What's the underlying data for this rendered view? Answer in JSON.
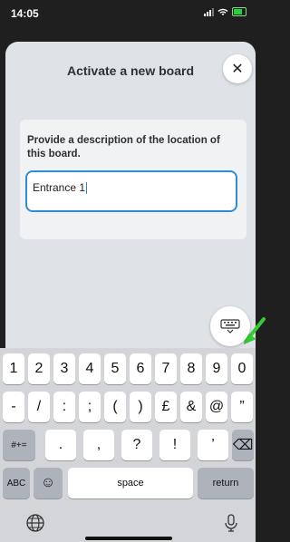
{
  "status": {
    "time": "14:05"
  },
  "sheet": {
    "title": "Activate a new board",
    "close_label": "✕"
  },
  "form": {
    "prompt": "Provide a description of the location of this board.",
    "value": "Entrance 1"
  },
  "keyboard": {
    "row1": [
      "1",
      "2",
      "3",
      "4",
      "5",
      "6",
      "7",
      "8",
      "9",
      "0"
    ],
    "row2": [
      "-",
      "/",
      ":",
      ";",
      "(",
      ")",
      "£",
      "&",
      "@",
      "”"
    ],
    "row3": {
      "shift": "#+=",
      "keys": [
        ".",
        ",",
        "?",
        "!",
        "’"
      ],
      "delete": "⌫"
    },
    "row4": {
      "abc": "ABC",
      "emoji": "☺",
      "space": "space",
      "return": "return"
    }
  },
  "colors": {
    "accent": "#2e8dd6",
    "arrow": "#33cc33",
    "sheet_bg": "#dfe2e7"
  },
  "icons": [
    "close-icon",
    "keyboard-hide-icon",
    "globe-icon",
    "microphone-icon",
    "backspace-icon",
    "emoji-icon"
  ]
}
